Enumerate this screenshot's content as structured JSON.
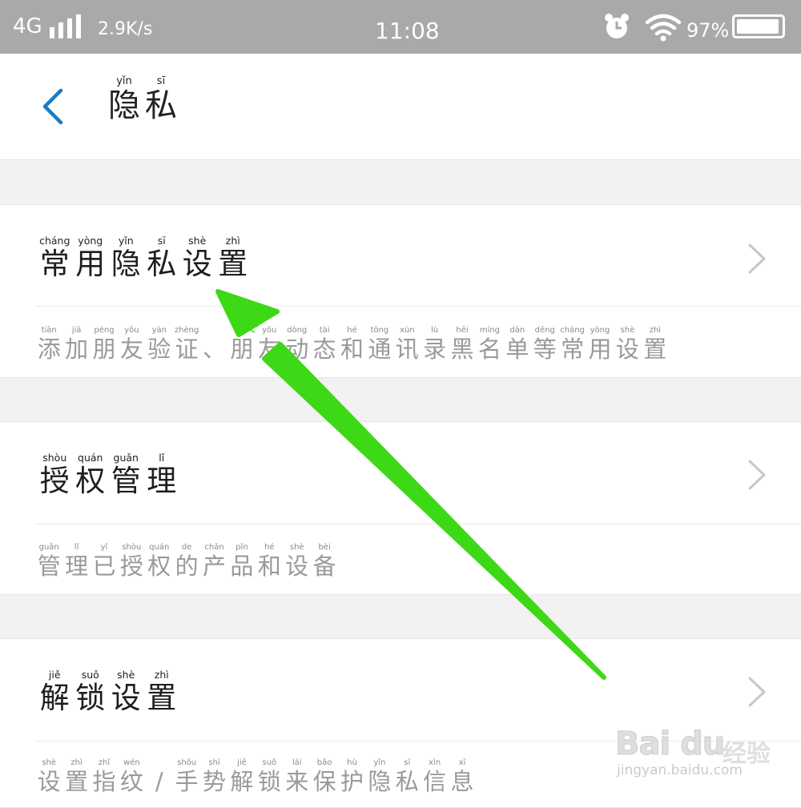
{
  "status_bar": {
    "network": "4G",
    "speed": "2.9K/s",
    "time": "11:08",
    "battery_percent": "97%",
    "battery_level": 0.97,
    "icons": [
      "signal-icon",
      "alarm-icon",
      "wifi-icon",
      "battery-icon"
    ]
  },
  "header": {
    "title": [
      {
        "py": "yǐn",
        "hz": "隐"
      },
      {
        "py": "sī",
        "hz": "私"
      }
    ],
    "back_icon": "chevron-left-icon",
    "accent": "#1a7bc4"
  },
  "settings": [
    {
      "title": [
        {
          "py": "cháng",
          "hz": "常"
        },
        {
          "py": "yòng",
          "hz": "用"
        },
        {
          "py": "yǐn",
          "hz": "隐"
        },
        {
          "py": "sī",
          "hz": "私"
        },
        {
          "py": "shè",
          "hz": "设"
        },
        {
          "py": "zhì",
          "hz": "置"
        }
      ],
      "description": [
        {
          "py": "tiān",
          "hz": "添"
        },
        {
          "py": "jiā",
          "hz": "加"
        },
        {
          "py": "péng",
          "hz": "朋"
        },
        {
          "py": "yǒu",
          "hz": "友"
        },
        {
          "py": "yàn",
          "hz": "验"
        },
        {
          "py": "zhèng",
          "hz": "证"
        },
        {
          "py": "",
          "hz": "、"
        },
        {
          "py": "",
          "hz": "朋"
        },
        {
          "py": "yǒu",
          "hz": "友"
        },
        {
          "py": "dòng",
          "hz": "动"
        },
        {
          "py": "tài",
          "hz": "态"
        },
        {
          "py": "hé",
          "hz": "和"
        },
        {
          "py": "tōng",
          "hz": "通"
        },
        {
          "py": "xùn",
          "hz": "讯"
        },
        {
          "py": "lù",
          "hz": "录"
        },
        {
          "py": "hēi",
          "hz": "黑"
        },
        {
          "py": "míng",
          "hz": "名"
        },
        {
          "py": "dān",
          "hz": "单"
        },
        {
          "py": "děng",
          "hz": "等"
        },
        {
          "py": "cháng",
          "hz": "常"
        },
        {
          "py": "yòng",
          "hz": "用"
        },
        {
          "py": "shè",
          "hz": "设"
        },
        {
          "py": "zhì",
          "hz": "置"
        }
      ]
    },
    {
      "title": [
        {
          "py": "shòu",
          "hz": "授"
        },
        {
          "py": "quán",
          "hz": "权"
        },
        {
          "py": "guǎn",
          "hz": "管"
        },
        {
          "py": "lǐ",
          "hz": "理"
        }
      ],
      "description": [
        {
          "py": "guǎn",
          "hz": "管"
        },
        {
          "py": "lǐ",
          "hz": "理"
        },
        {
          "py": "yǐ",
          "hz": "已"
        },
        {
          "py": "shòu",
          "hz": "授"
        },
        {
          "py": "quán",
          "hz": "权"
        },
        {
          "py": "de",
          "hz": "的"
        },
        {
          "py": "chǎn",
          "hz": "产"
        },
        {
          "py": "pǐn",
          "hz": "品"
        },
        {
          "py": "hé",
          "hz": "和"
        },
        {
          "py": "shè",
          "hz": "设"
        },
        {
          "py": "bèi",
          "hz": "备"
        }
      ]
    },
    {
      "title": [
        {
          "py": "jiě",
          "hz": "解"
        },
        {
          "py": "suǒ",
          "hz": "锁"
        },
        {
          "py": "shè",
          "hz": "设"
        },
        {
          "py": "zhì",
          "hz": "置"
        }
      ],
      "description": [
        {
          "py": "shè",
          "hz": "设"
        },
        {
          "py": "zhì",
          "hz": "置"
        },
        {
          "py": "zhǐ",
          "hz": "指"
        },
        {
          "py": "wén",
          "hz": "纹"
        },
        {
          "py": "",
          "hz": "/"
        },
        {
          "py": "shǒu",
          "hz": "手"
        },
        {
          "py": "shì",
          "hz": "势"
        },
        {
          "py": "jiě",
          "hz": "解"
        },
        {
          "py": "suǒ",
          "hz": "锁"
        },
        {
          "py": "lái",
          "hz": "来"
        },
        {
          "py": "bǎo",
          "hz": "保"
        },
        {
          "py": "hù",
          "hz": "护"
        },
        {
          "py": "yǐn",
          "hz": "隐"
        },
        {
          "py": "sī",
          "hz": "私"
        },
        {
          "py": "xìn",
          "hz": "信"
        },
        {
          "py": "xī",
          "hz": "息"
        }
      ]
    }
  ],
  "annotation": {
    "color": "#3dd816",
    "type": "arrow",
    "points_to": "常用隐私设置"
  },
  "watermark": {
    "brand": "Bai du",
    "product": "经验",
    "url": "jingyan.baidu.com"
  }
}
